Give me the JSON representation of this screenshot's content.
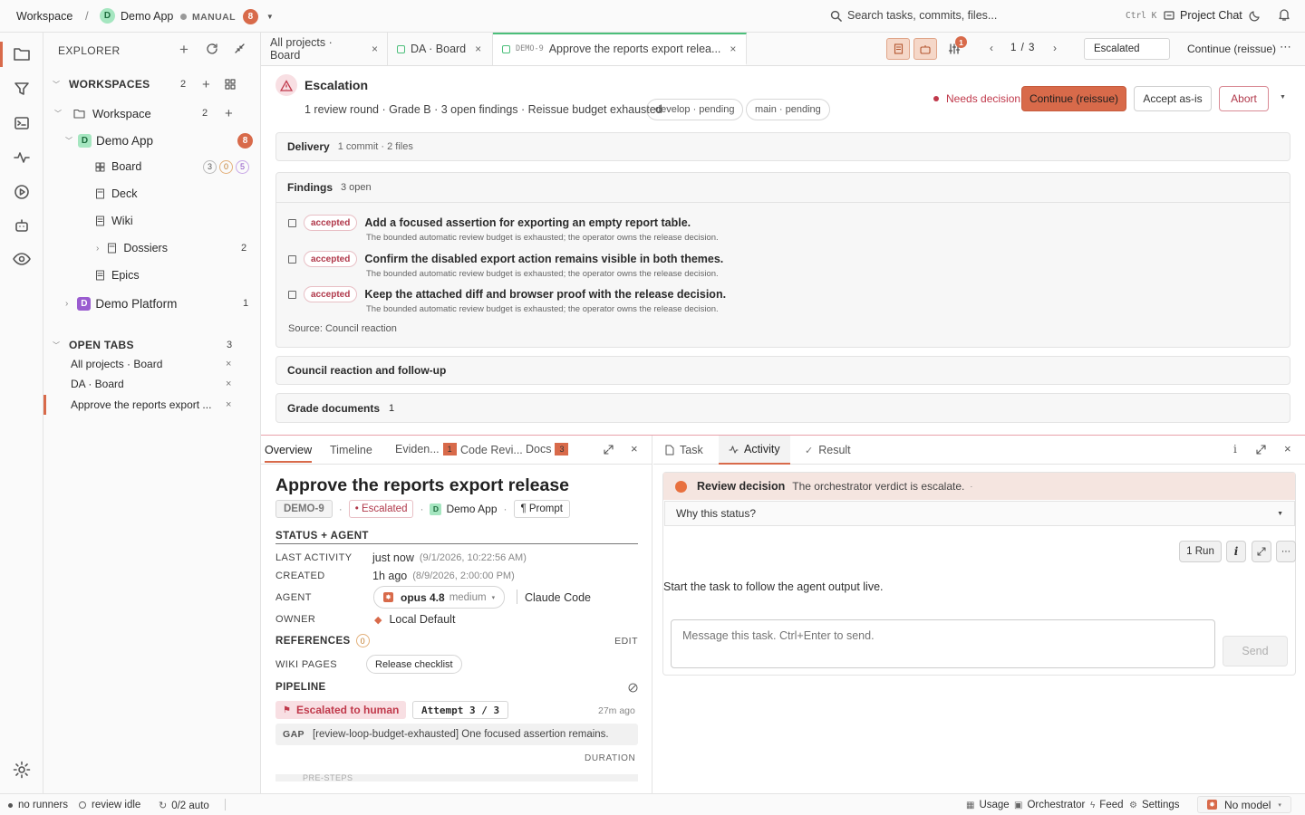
{
  "topbar": {
    "workspace": "Workspace",
    "separator": "/",
    "app_initial": "D",
    "app_name": "Demo App",
    "mode": "MANUAL",
    "mode_count": "8",
    "search_placeholder": "Search tasks, commits, files...",
    "shortcut": "Ctrl K",
    "project_chat": "Project Chat"
  },
  "explorer": {
    "title": "EXPLORER",
    "workspaces_label": "WORKSPACES",
    "workspaces_count": "2",
    "workspace_name": "Workspace",
    "workspace_count": "2",
    "demo_app": {
      "initial": "D",
      "name": "Demo App",
      "count": "8"
    },
    "board": {
      "label": "Board",
      "n1": "3",
      "n2": "0",
      "n3": "5"
    },
    "deck": "Deck",
    "wiki": "Wiki",
    "dossiers": {
      "label": "Dossiers",
      "count": "2"
    },
    "epics": "Epics",
    "demo_platform": {
      "initial": "D",
      "name": "Demo Platform",
      "count": "1"
    },
    "open_tabs_label": "OPEN TABS",
    "open_tabs_count": "3",
    "open_tabs": [
      "All projects · Board",
      "DA · Board",
      "Approve the reports export ..."
    ]
  },
  "tabs": {
    "items": [
      {
        "label": "All projects · Board"
      },
      {
        "label": "DA · Board"
      },
      {
        "id": "DEMO-9",
        "label": "Approve the reports export relea..."
      }
    ],
    "pager": "1 / 3",
    "filter_value": "Escalated",
    "continue_label": "Continue (reissue)",
    "notif_count": "1"
  },
  "escalation": {
    "title": "Escalation",
    "summary": "1 review round · Grade B · 3 open findings · Reissue budget exhausted",
    "chips": [
      "develop · pending",
      "main · pending"
    ],
    "needs_decision": "Needs decision",
    "continue_btn": "Continue (reissue)",
    "accept_btn": "Accept as-is",
    "abort_btn": "Abort"
  },
  "delivery": {
    "label": "Delivery",
    "detail": "1 commit · 2 files"
  },
  "findings": {
    "label": "Findings",
    "count": "3 open",
    "items": [
      {
        "badge": "accepted",
        "title": "Add a focused assertion for exporting an empty report table.",
        "note": "The bounded automatic review budget is exhausted; the operator owns the release decision."
      },
      {
        "badge": "accepted",
        "title": "Confirm the disabled export action remains visible in both themes.",
        "note": "The bounded automatic review budget is exhausted; the operator owns the release decision."
      },
      {
        "badge": "accepted",
        "title": "Keep the attached diff and browser proof with the release decision.",
        "note": "The bounded automatic review budget is exhausted; the operator owns the release decision."
      }
    ],
    "source": "Source: Council reaction"
  },
  "council": {
    "label": "Council reaction and follow-up"
  },
  "grade_docs": {
    "label": "Grade documents",
    "count": "1"
  },
  "detail_tabs": {
    "overview": "Overview",
    "timeline": "Timeline",
    "evidence": "Eviden...",
    "evidence_count": "1",
    "code_review": "Code Revi...",
    "docs": "Docs",
    "docs_count": "3"
  },
  "task": {
    "title": "Approve the reports export release",
    "id": "DEMO-9",
    "status": "• Escalated",
    "project_initial": "D",
    "project": "Demo App",
    "prompt": "¶ Prompt",
    "status_agent_h": "STATUS + AGENT",
    "last_activity_l": "LAST ACTIVITY",
    "last_activity_v": "just now",
    "last_activity_t": "(9/1/2026, 10:22:56 AM)",
    "created_l": "CREATED",
    "created_v": "1h ago",
    "created_t": "(8/9/2026, 2:00:00 PM)",
    "agent_l": "AGENT",
    "agent_model": "opus 4.8",
    "agent_effort": "medium",
    "agent_tool": "Claude Code",
    "owner_l": "OWNER",
    "owner_v": "Local Default",
    "references_h": "REFERENCES",
    "references_count": "0",
    "edit": "EDIT",
    "wiki_pages_l": "WIKI PAGES",
    "wiki_page": "Release checklist",
    "pipeline_h": "PIPELINE",
    "pipeline_status": "Escalated to human",
    "attempt": "Attempt 3 / 3",
    "pipeline_time": "27m ago",
    "gap_l": "GAP",
    "gap_v": "[review-loop-budget-exhausted] One focused assertion remains.",
    "duration": "DURATION",
    "pre_steps": "PRE-STEPS"
  },
  "activity": {
    "tab_task": "Task",
    "tab_activity": "Activity",
    "tab_result": "Result",
    "review_title": "Review decision",
    "review_text": "The orchestrator verdict is escalate.",
    "why": "Why this status?",
    "run_btn": "1 Run",
    "empty": "Start the task to follow the agent output live.",
    "message_placeholder": "Message this task. Ctrl+Enter to send.",
    "send": "Send"
  },
  "statusbar": {
    "runners": "no runners",
    "review": "review idle",
    "auto": "0/2 auto",
    "usage": "Usage",
    "orchestrator": "Orchestrator",
    "feed": "Feed",
    "settings": "Settings",
    "model": "No model"
  },
  "colors": {
    "accent": "#d86a4a",
    "danger": "#c0394b",
    "green": "#4bbf7a",
    "purple": "#9a5cd0"
  }
}
